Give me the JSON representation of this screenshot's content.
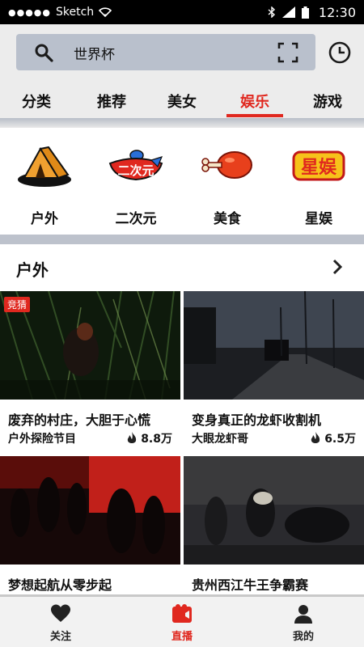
{
  "status_bar": {
    "signal_dots": "●●●●●",
    "carrier": "Sketch",
    "time": "12:30"
  },
  "search": {
    "query": "世界杯"
  },
  "tabs": [
    {
      "label": "分类",
      "active": false
    },
    {
      "label": "推荐",
      "active": false
    },
    {
      "label": "美女",
      "active": false
    },
    {
      "label": "娱乐",
      "active": true
    },
    {
      "label": "游戏",
      "active": false
    }
  ],
  "categories": [
    {
      "label": "户外",
      "icon": "tent-icon"
    },
    {
      "label": "二次元",
      "icon": "anime-logo-icon"
    },
    {
      "label": "美食",
      "icon": "drumstick-icon"
    },
    {
      "label": "星娱",
      "icon": "star-entertainment-logo-icon"
    }
  ],
  "section": {
    "title": "户外"
  },
  "videos": [
    {
      "title": "废弃的村庄，大胆于心慌",
      "channel": "户外探险节目",
      "views": "8.8万",
      "badge": "竞猜"
    },
    {
      "title": "变身真正的龙虾收割机",
      "channel": "大眼龙虾哥",
      "views": "6.5万"
    },
    {
      "title": "梦想起航从零步起"
    },
    {
      "title": "贵州西江牛王争霸赛"
    }
  ],
  "bottom_nav": [
    {
      "label": "关注",
      "icon": "heart-icon",
      "active": false
    },
    {
      "label": "直播",
      "icon": "live-camera-icon",
      "active": true
    },
    {
      "label": "我的",
      "icon": "user-icon",
      "active": false
    }
  ],
  "colors": {
    "accent": "#e0281f",
    "search_bg": "#b9c0cc",
    "header_bg": "#ececec"
  }
}
